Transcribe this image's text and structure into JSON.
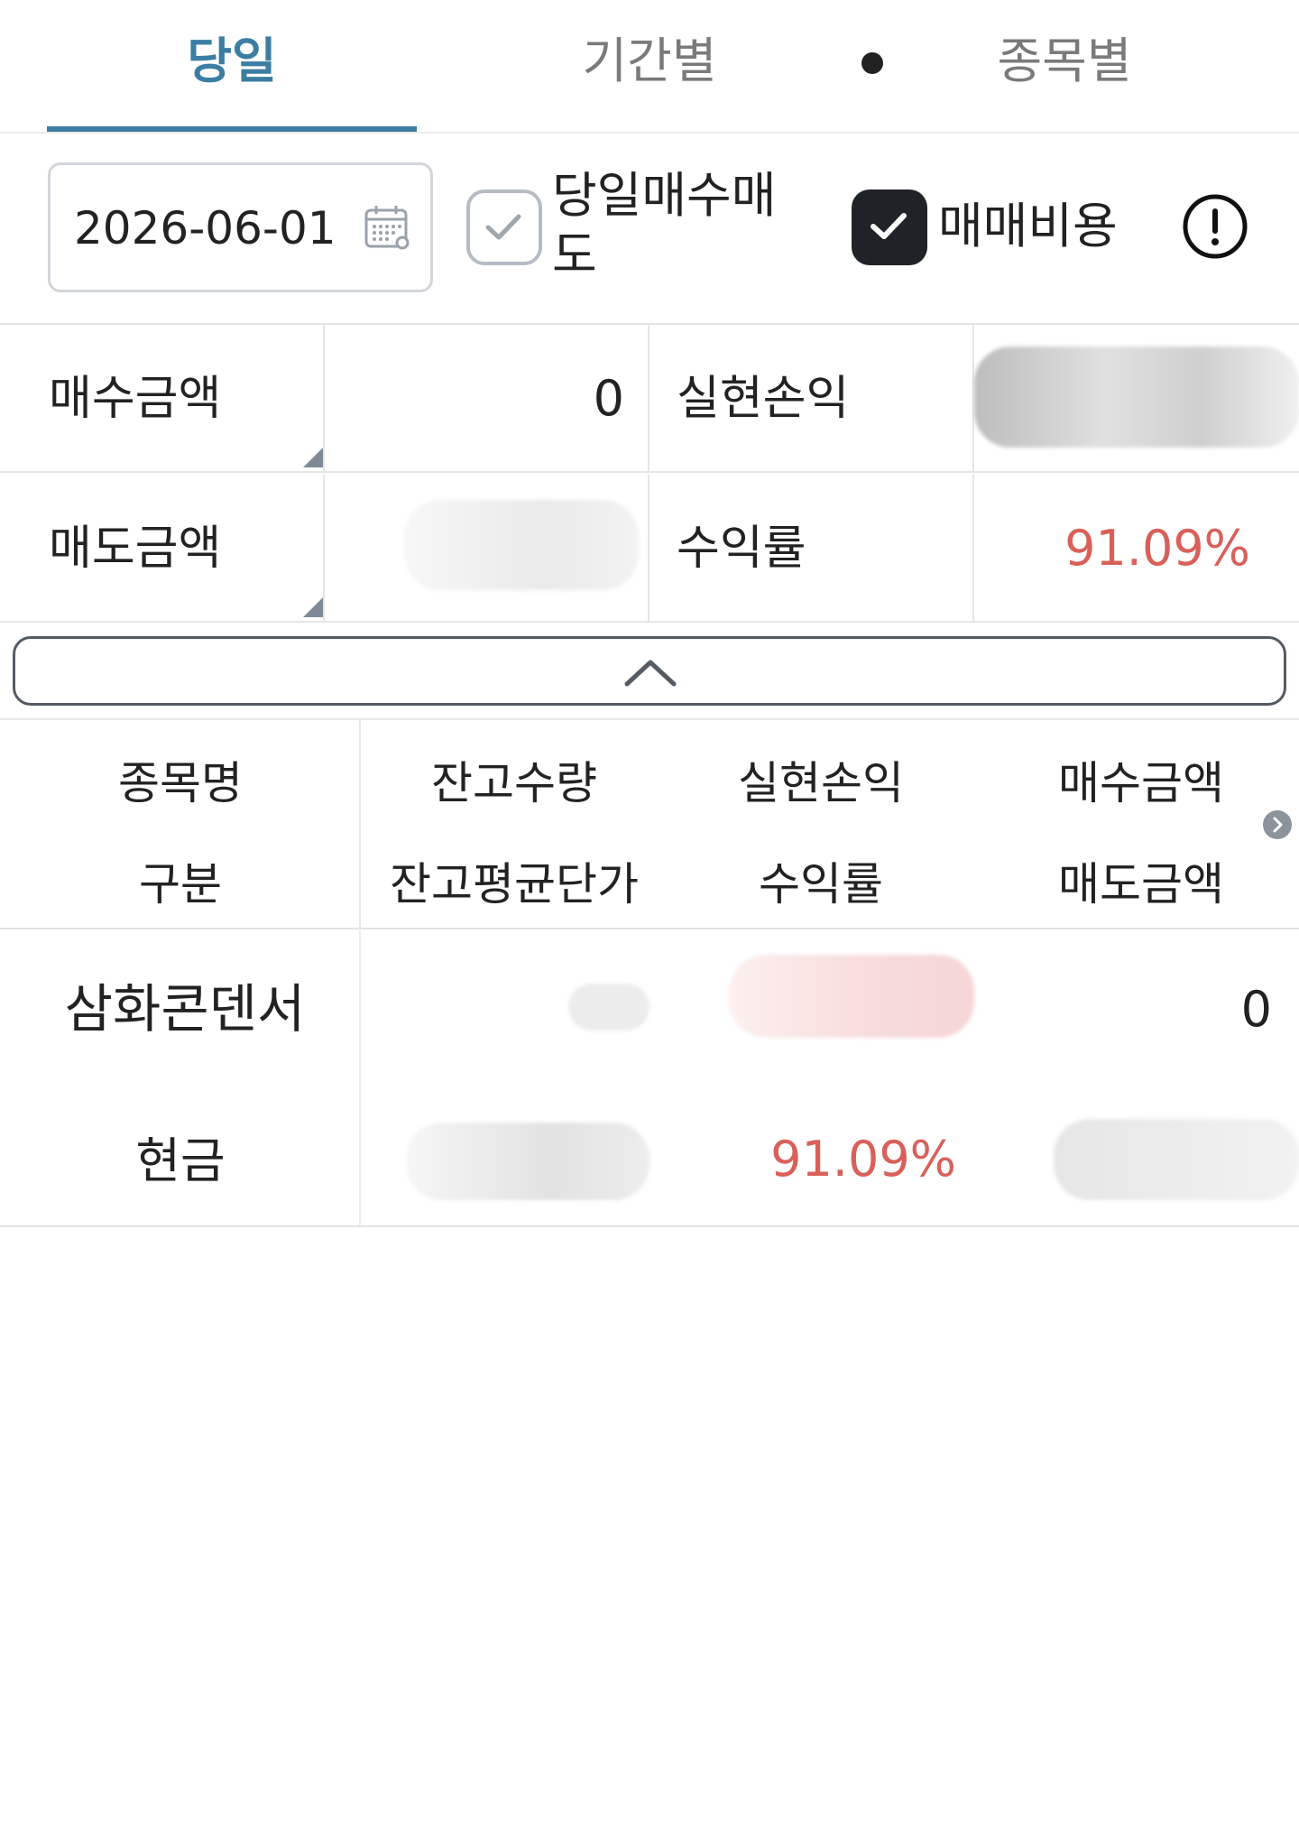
{
  "tabs": [
    {
      "label": "당일",
      "active": true
    },
    {
      "label": "기간별",
      "active": false
    },
    {
      "label": "종목별",
      "active": false
    }
  ],
  "filter": {
    "date": "2026-06-01",
    "same_day_trade_label": "당일매수매도",
    "same_day_trade_checked": false,
    "trade_fee_label": "매매비용",
    "trade_fee_checked": true
  },
  "summary": {
    "buy_amount_label": "매수금액",
    "buy_amount_value": "0",
    "realized_pl_label": "실현손익",
    "sell_amount_label": "매도금액",
    "return_rate_label": "수익률",
    "return_rate_value": "91.09%"
  },
  "list": {
    "headers_row1": [
      "종목명",
      "잔고수량",
      "실현손익",
      "매수금액"
    ],
    "headers_row2": [
      "구분",
      "잔고평균단가",
      "수익률",
      "매도금액"
    ],
    "rows": [
      {
        "name": "삼화콘덴서",
        "type": "현금",
        "buy_amount": "0",
        "return_rate": "91.09%"
      }
    ]
  },
  "colors": {
    "accent": "#3c7ea3",
    "loss_red": "#d9605a",
    "checkbox_dark": "#1f2227"
  }
}
